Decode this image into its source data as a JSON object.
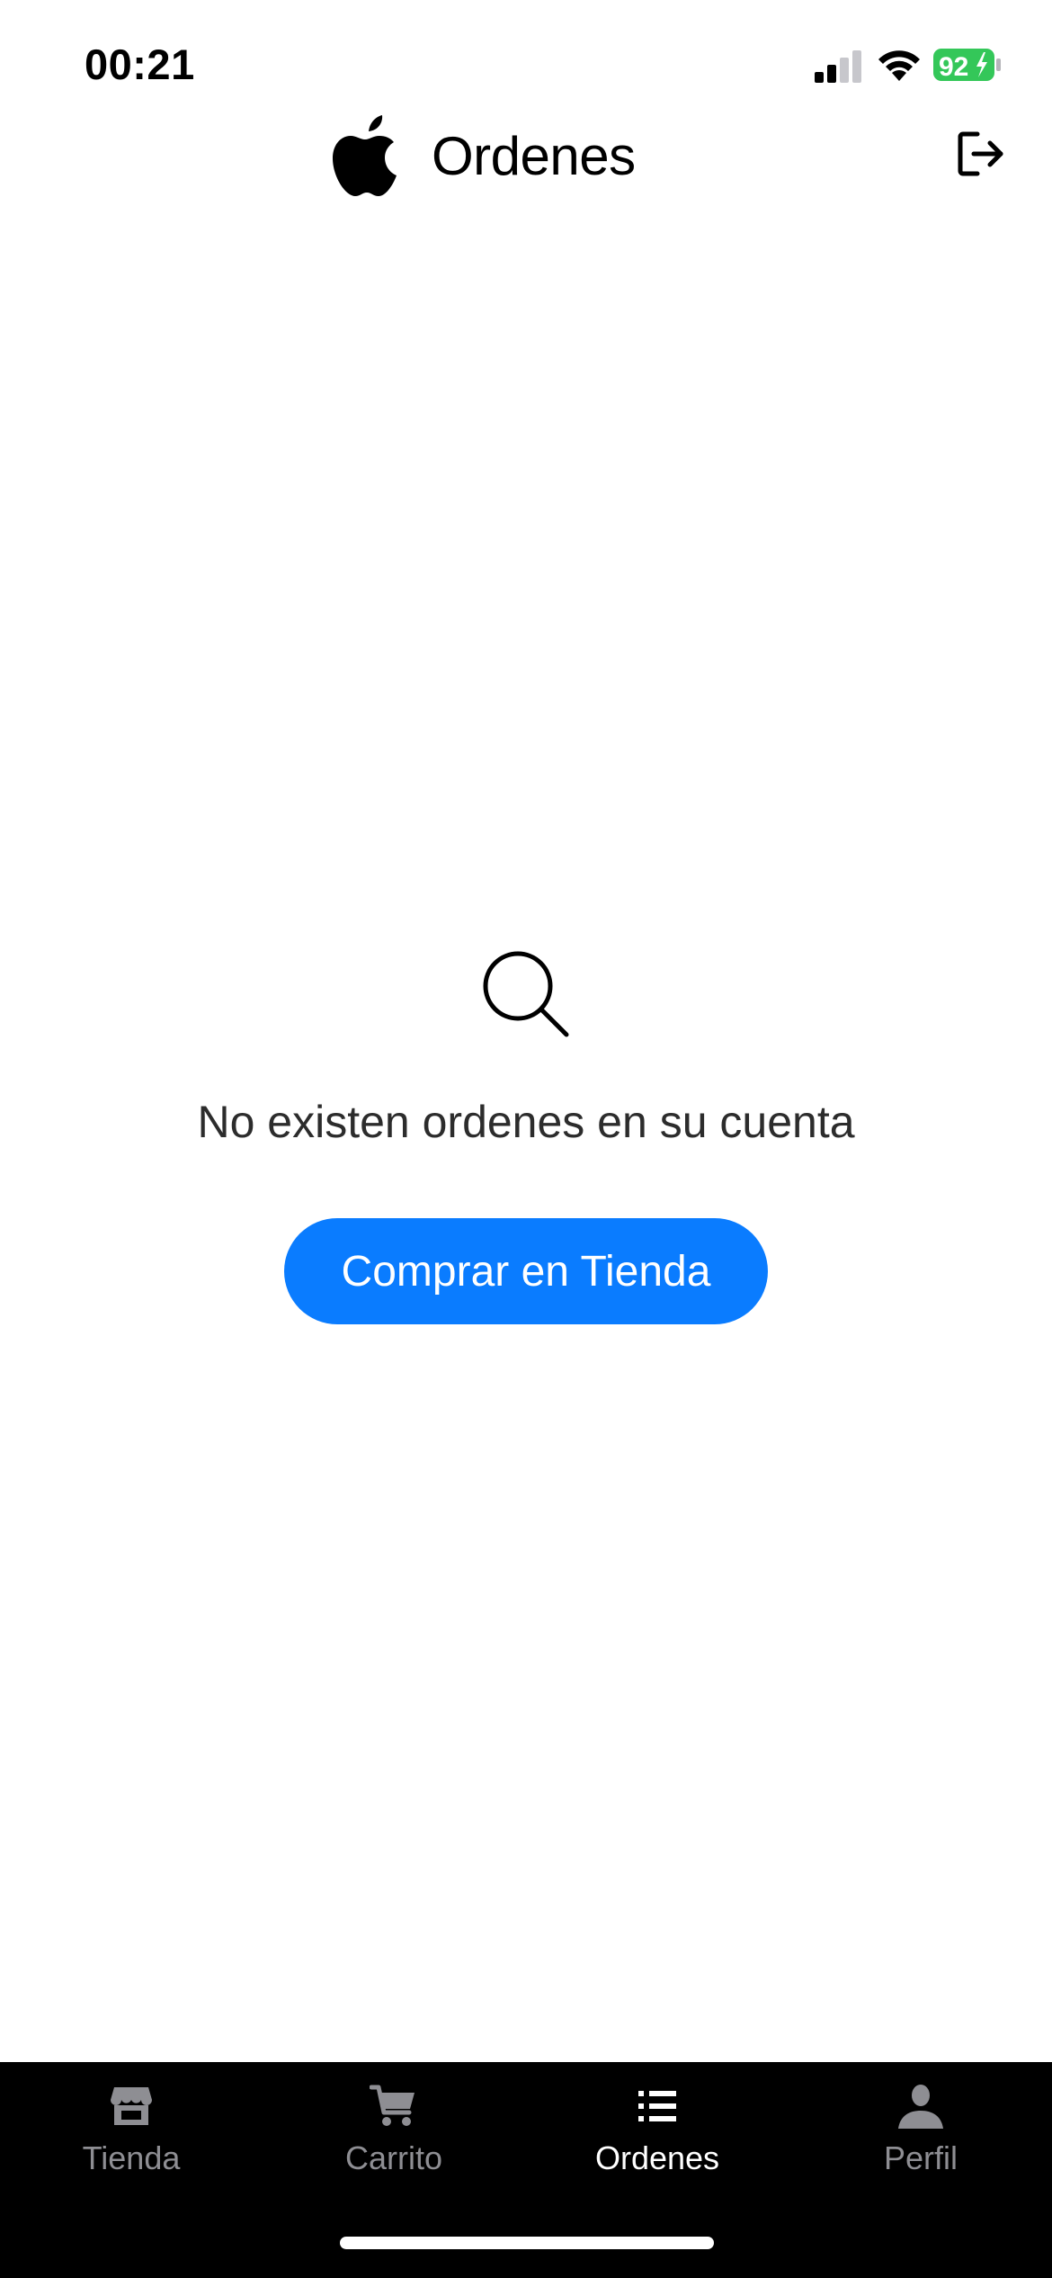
{
  "status_bar": {
    "time": "00:21",
    "battery": "92",
    "battery_color": "#34c759",
    "icons": [
      "signal-icon",
      "wifi-icon",
      "battery-charging-icon"
    ]
  },
  "header": {
    "title": "Ordenes",
    "logo_icon": "apple-logo-icon",
    "logout_icon": "logout-icon"
  },
  "empty_state": {
    "icon": "search-icon",
    "message": "No existen ordenes en su cuenta",
    "button_label": "Comprar en Tienda",
    "button_color": "#0a7cff"
  },
  "tab_bar": {
    "tabs": [
      {
        "label": "Tienda",
        "icon": "store-icon",
        "active": false
      },
      {
        "label": "Carrito",
        "icon": "cart-icon",
        "active": false
      },
      {
        "label": "Ordenes",
        "icon": "list-icon",
        "active": true
      },
      {
        "label": "Perfil",
        "icon": "person-icon",
        "active": false
      }
    ],
    "active_color": "#ffffff",
    "inactive_color": "#8e8e93"
  }
}
